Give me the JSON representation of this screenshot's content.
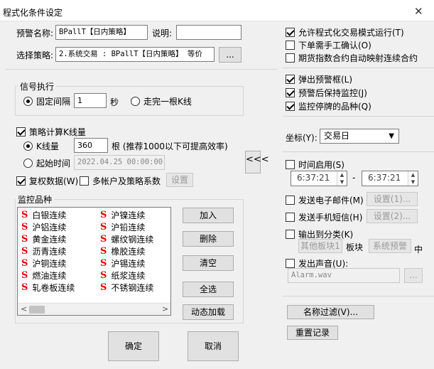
{
  "window": {
    "title": "程式化条件设定",
    "close": "✕"
  },
  "alert": {
    "name_label": "预警名称",
    "name_value": "BPallT【日内策略】",
    "desc_label": "说明",
    "desc_value": "",
    "strategy_label": "选择策略",
    "strategy_value": "2.系统交易 : BPallT【日内策略】 等价",
    "strategy_btn": "..."
  },
  "signal": {
    "group_label": "信号执行",
    "fixed_label": "固定间隔",
    "fixed_value": "1",
    "sec_unit": "秒",
    "kline_label": "走完一根K线"
  },
  "strategy_calc": {
    "check_label": "策略计算K线量",
    "kline_label": "K线量",
    "kline_value": "360",
    "kline_hint": "根 (推荐1000以下可提高效率)",
    "start_label": "起始时间",
    "start_value": "2022.04.25 00:00:00",
    "restore_label": "复权数据(W)",
    "multi_label": "多帐户及策略系数",
    "setup_btn": "设置",
    "collapse_btn": "<<<"
  },
  "monitor": {
    "group_label": "监控品种",
    "items_left": [
      "白银连续",
      "沪铝连续",
      "黄金连续",
      "沥青连续",
      "沪铜连续",
      "燃油连续",
      "轧卷板连续"
    ],
    "items_right": [
      "沪镍连续",
      "沪铅连续",
      "螺纹钢连续",
      "橡胶连续",
      "沪锡连续",
      "纸浆连续",
      "不锈钢连续"
    ],
    "item_icon": "S",
    "add_btn": "加入",
    "delete_btn": "删除",
    "clear_btn": "清空",
    "select_all_btn": "全选",
    "dynamic_load_btn": "动态加载",
    "scroll_left": "<",
    "scroll_right": ">"
  },
  "right": {
    "allow_auto": "允许程式化交易模式运行(T)",
    "manual_confirm": "下单需手工确认(O)",
    "index_map": "期货指数合约自动映射连续合约",
    "popup_alert": "弹出预警框(L)",
    "keep_monitor": "预警后保持监控(J)",
    "monitor_halted": "监控停牌的品种(Q)",
    "coord_label": "坐标(Y):",
    "coord_value": "交易日",
    "time_enable": "时间启用(S)",
    "time_from": "6:37:21",
    "time_dash": "-",
    "time_to": "6:37:21",
    "send_email": "发送电子邮件(M)",
    "email_setup": "设置(1)...",
    "send_sms": "发送手机短信(H)",
    "sms_setup": "设置(2)...",
    "output_category": "输出到分类(K)",
    "other_board": "其他板块1",
    "board_label": "板块",
    "system_alert": "系统预警",
    "middle_char": "中",
    "play_sound": "发出声音(U):",
    "sound_file": "Alarm.wav",
    "sound_btn": "...",
    "name_filter": "名称过滤(V)...",
    "reset_record": "重置记录"
  },
  "footer": {
    "ok": "确定",
    "cancel": "取消"
  }
}
